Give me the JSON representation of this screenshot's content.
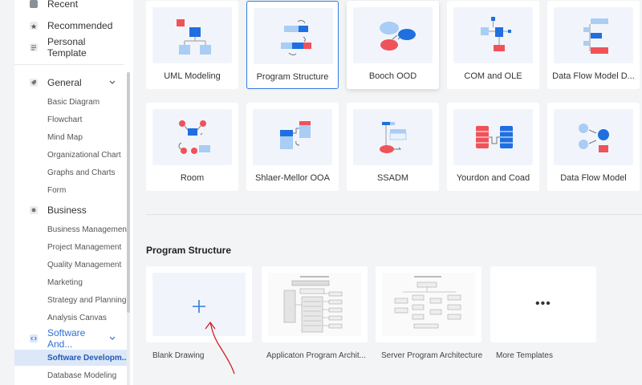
{
  "sidebar": {
    "top_items": [
      {
        "label": "Recent",
        "icon": "clock-icon"
      },
      {
        "label": "Recommended",
        "icon": "star-icon"
      },
      {
        "label": "Personal Template",
        "icon": "template-icon"
      }
    ],
    "categories": [
      {
        "label": "General",
        "icon": "tag-icon",
        "expanded": true,
        "items": [
          "Basic Diagram",
          "Flowchart",
          "Mind Map",
          "Organizational Chart",
          "Graphs and Charts",
          "Form"
        ]
      },
      {
        "label": "Business",
        "icon": "business-icon",
        "expanded": true,
        "items": [
          "Business Management",
          "Project Management",
          "Quality Management",
          "Marketing",
          "Strategy and Planning",
          "Analysis Canvas"
        ]
      },
      {
        "label": "Software And...",
        "icon": "code-icon",
        "expanded": true,
        "items": [
          "Software Developm...",
          "Database Modeling"
        ]
      }
    ],
    "active_item": "Software Developm..."
  },
  "diagram_types": [
    {
      "label": "UML Modeling",
      "icon": "uml-diagram-icon"
    },
    {
      "label": "Program Structure",
      "icon": "program-structure-icon",
      "selected": true
    },
    {
      "label": "Booch OOD",
      "icon": "booch-cloud-icon",
      "hover": true
    },
    {
      "label": "COM and OLE",
      "icon": "com-ole-icon"
    },
    {
      "label": "Data Flow Model D...",
      "icon": "data-flow-model-icon"
    },
    {
      "label": "Room",
      "icon": "room-diagram-icon"
    },
    {
      "label": "Shlaer-Mellor OOA",
      "icon": "shlaer-mellor-icon"
    },
    {
      "label": "SSADM",
      "icon": "ssadm-icon"
    },
    {
      "label": "Yourdon and Coad",
      "icon": "yourdon-coad-icon"
    },
    {
      "label": "Data Flow Model",
      "icon": "data-flow-icon"
    }
  ],
  "templates_section": {
    "title": "Program Structure",
    "items": [
      {
        "label": "Blank Drawing",
        "icon": "plus-icon"
      },
      {
        "label": "Applicaton Program Archit...",
        "icon": "architecture-thumbnail"
      },
      {
        "label": "Server Program Architecture",
        "icon": "server-architecture-thumbnail"
      },
      {
        "label": "More Templates",
        "icon": "more-icon"
      }
    ]
  },
  "colors": {
    "accent": "#2f7de1",
    "red": "#f0525a",
    "blue": "#1f6fe0",
    "light_blue": "#a9cdf5",
    "active_bg": "#dce8f8",
    "annotation": "#d0202a"
  }
}
